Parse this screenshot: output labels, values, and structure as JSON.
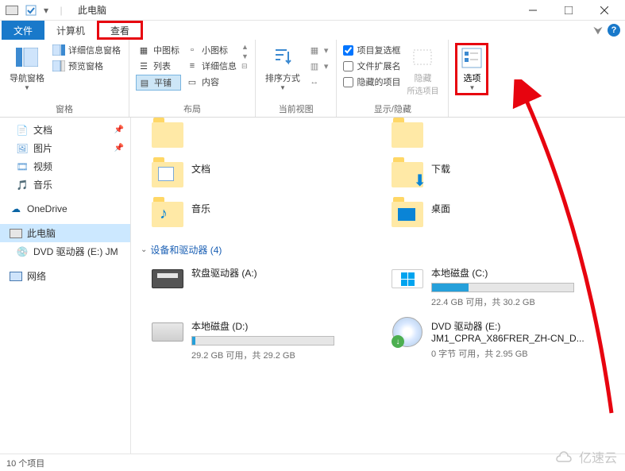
{
  "titlebar": {
    "title": "此电脑",
    "qat_checked": true
  },
  "tabs": {
    "file": "文件",
    "computer": "计算机",
    "view": "查看"
  },
  "ribbon": {
    "panes": {
      "nav_pane": "导航窗格",
      "preview_pane": "预览窗格",
      "detail_pane": "详细信息窗格",
      "group_label": "窗格"
    },
    "layout": {
      "medium_icons": "中图标",
      "small_icons": "小图标",
      "list": "列表",
      "details": "详细信息",
      "tiles": "平铺",
      "content": "内容",
      "group_label": "布局"
    },
    "current_view": {
      "sort_by": "排序方式",
      "group_label": "当前视图"
    },
    "show_hide": {
      "chk_item_checkbox": "项目复选框",
      "chk_file_ext": "文件扩展名",
      "chk_hidden_items": "隐藏的项目",
      "hide": "隐藏所选项目",
      "hide_short": "隐藏",
      "group_label": "显示/隐藏",
      "chk_item_checkbox_on": true,
      "chk_file_ext_on": false,
      "chk_hidden_items_on": false
    },
    "options": "选项"
  },
  "sidebar": {
    "items": [
      {
        "label": "文档",
        "pinned": true,
        "icon": "doc"
      },
      {
        "label": "图片",
        "pinned": true,
        "icon": "pic"
      },
      {
        "label": "视频",
        "pinned": false,
        "icon": "vid"
      },
      {
        "label": "音乐",
        "pinned": false,
        "icon": "mus"
      },
      {
        "label": "OneDrive",
        "pinned": false,
        "icon": "onedrive"
      },
      {
        "label": "此电脑",
        "pinned": false,
        "icon": "thispc",
        "selected": true
      },
      {
        "label": "DVD 驱动器 (E:) JM",
        "pinned": false,
        "icon": "dvd"
      },
      {
        "label": "网络",
        "pinned": false,
        "icon": "net"
      }
    ]
  },
  "main": {
    "folders": [
      {
        "label": "文档"
      },
      {
        "label": "下载"
      },
      {
        "label": "音乐"
      },
      {
        "label": "桌面"
      }
    ],
    "devices_header": "设备和驱动器 (4)",
    "devices": [
      {
        "label": "软盘驱动器 (A:)",
        "sub": "",
        "type": "floppy"
      },
      {
        "label": "本地磁盘 (C:)",
        "sub": "22.4 GB 可用，共 30.2 GB",
        "type": "win",
        "fill": 26
      },
      {
        "label": "本地磁盘 (D:)",
        "sub": "29.2 GB 可用，共 29.2 GB",
        "type": "hdd",
        "fill": 2
      },
      {
        "label": "DVD 驱动器 (E:)",
        "label2": "JM1_CPRA_X86FRER_ZH-CN_D...",
        "sub": "0 字节 可用，共 2.95 GB",
        "type": "dvd"
      }
    ]
  },
  "statusbar": {
    "text": "10 个项目"
  },
  "watermark": "亿速云",
  "colors": {
    "highlight": "#e7040f",
    "accent": "#1979ca"
  }
}
